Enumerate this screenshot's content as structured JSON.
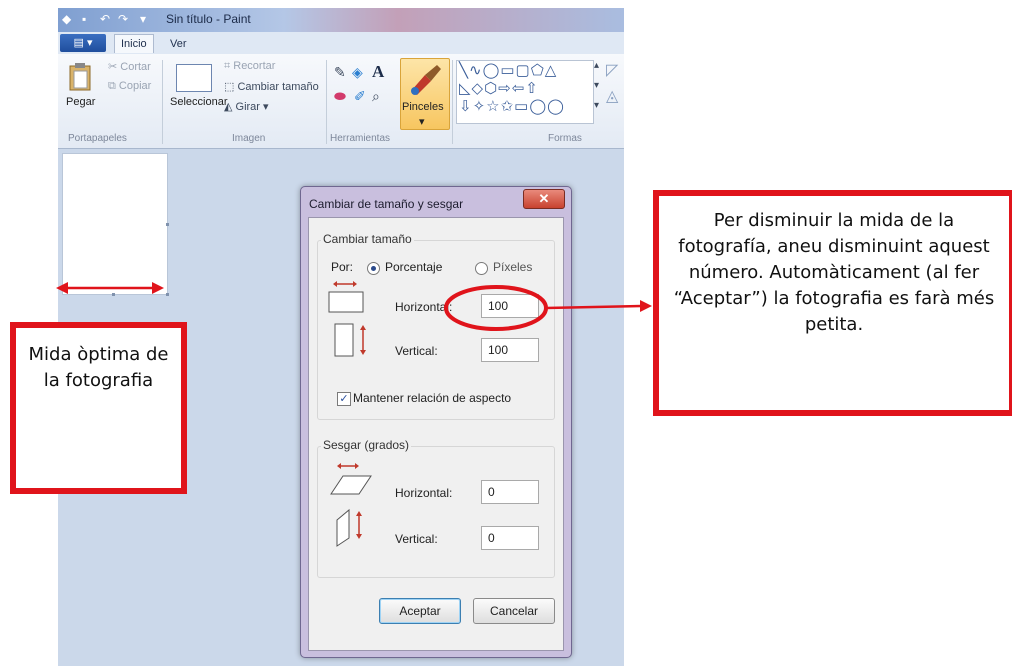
{
  "window": {
    "title": "Sin título - Paint",
    "tabs": [
      "Inicio",
      "Ver"
    ]
  },
  "ribbon": {
    "clipboard": {
      "paste": "Pegar",
      "cut": "Cortar",
      "copy": "Copiar",
      "group": "Portapapeles"
    },
    "image": {
      "select": "Seleccionar",
      "crop": "Recortar",
      "resize": "Cambiar tamaño",
      "rotate": "Girar",
      "group": "Imagen"
    },
    "tools": {
      "group": "Herramientas",
      "text_tool": "A"
    },
    "brushes": {
      "label": "Pinceles"
    },
    "shapes": {
      "group": "Formas"
    }
  },
  "dialog": {
    "title": "Cambiar de tamaño y sesgar",
    "resize": {
      "legend": "Cambiar tamaño",
      "by_label": "Por:",
      "option_percent": "Porcentaje",
      "option_pixels": "Píxeles",
      "selected": "Porcentaje",
      "horizontal_label": "Horizontal:",
      "horizontal_value": "100",
      "vertical_label": "Vertical:",
      "vertical_value": "100",
      "keep_aspect": "Mantener relación de aspecto",
      "keep_aspect_checked": true
    },
    "skew": {
      "legend": "Sesgar (grados)",
      "horizontal_label": "Horizontal:",
      "horizontal_value": "0",
      "vertical_label": "Vertical:",
      "vertical_value": "0"
    },
    "ok": "Aceptar",
    "cancel": "Cancelar"
  },
  "annotations": {
    "right_note": "Per disminuir la mida de la fotografía, aneu disminuint aquest número. Automàticament (al fer “Aceptar”) la fotografia es farà més petita.",
    "left_note": "Mida òptima de la fotografia",
    "color": "#e0141b"
  }
}
